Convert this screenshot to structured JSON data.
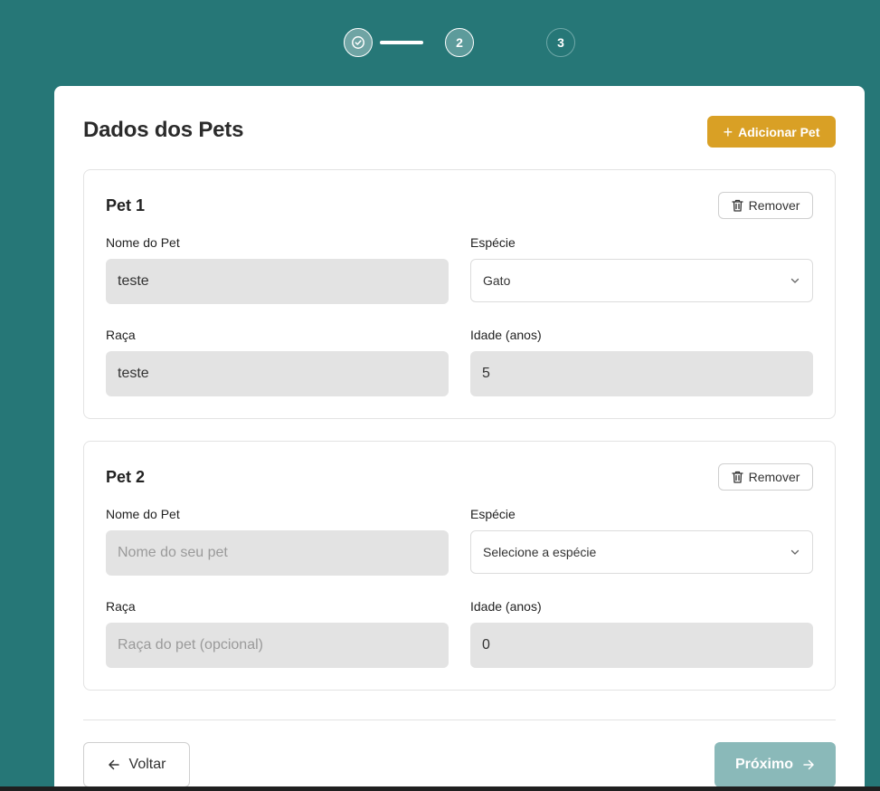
{
  "stepper": {
    "step1_icon": "check-circle-icon",
    "step2_label": "2",
    "step3_label": "3"
  },
  "page": {
    "title": "Dados dos Pets",
    "add_button_label": "Adicionar Pet",
    "add_icon": "plus-icon"
  },
  "pets": [
    {
      "title": "Pet 1",
      "remove_label": "Remover",
      "name_label": "Nome do Pet",
      "name_value": "teste",
      "name_placeholder": "Nome do seu pet",
      "species_label": "Espécie",
      "species_value": "Gato",
      "breed_label": "Raça",
      "breed_value": "teste",
      "breed_placeholder": "Raça do pet (opcional)",
      "age_label": "Idade (anos)",
      "age_value": "5"
    },
    {
      "title": "Pet 2",
      "remove_label": "Remover",
      "name_label": "Nome do Pet",
      "name_value": "",
      "name_placeholder": "Nome do seu pet",
      "species_label": "Espécie",
      "species_value": "Selecione a espécie",
      "breed_label": "Raça",
      "breed_value": "",
      "breed_placeholder": "Raça do pet (opcional)",
      "age_label": "Idade (anos)",
      "age_value": "0"
    }
  ],
  "footer": {
    "back_label": "Voltar",
    "next_label": "Próximo"
  },
  "colors": {
    "background": "#267777",
    "accent": "#d9a025",
    "next_disabled": "#8ab9b9"
  }
}
